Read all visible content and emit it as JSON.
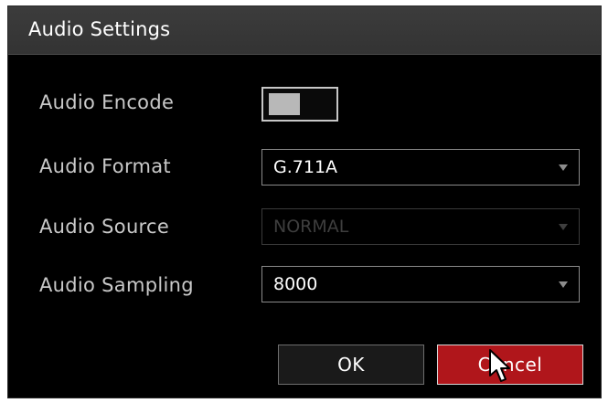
{
  "dialog": {
    "title": "Audio Settings"
  },
  "fields": {
    "audio_encode": {
      "label": "Audio Encode",
      "enabled": false
    },
    "audio_format": {
      "label": "Audio Format",
      "value": "G.711A"
    },
    "audio_source": {
      "label": "Audio Source",
      "value": "NORMAL",
      "disabled": true
    },
    "audio_sampling": {
      "label": "Audio Sampling",
      "value": "8000"
    }
  },
  "buttons": {
    "ok": "OK",
    "cancel": "Cancel"
  },
  "icons": {
    "dropdown": "chevron-down-icon",
    "cursor": "mouse-pointer-icon"
  },
  "colors": {
    "title_bar": "#363636",
    "background": "#000000",
    "cancel_button": "#b0161b",
    "label_text": "#c9c9c9",
    "disabled_text": "#3e3e3e"
  }
}
